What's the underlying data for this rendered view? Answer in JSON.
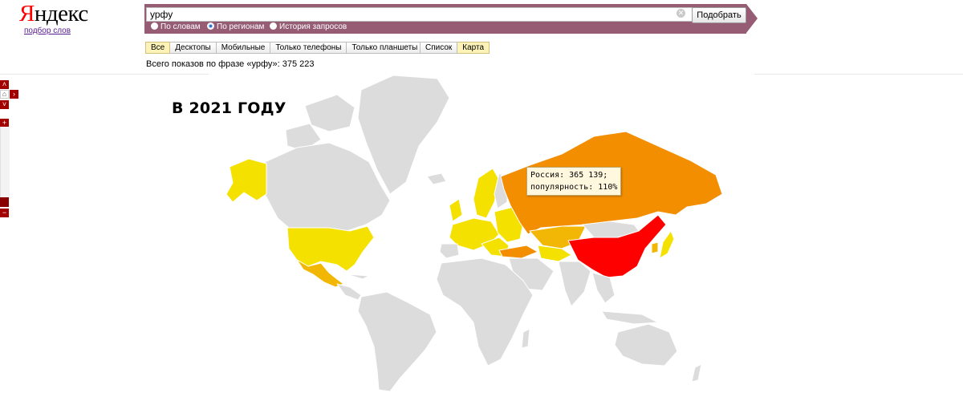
{
  "logo": {
    "brand": "Яндекс",
    "subtitle": "подбор слов"
  },
  "search": {
    "query": "урфу",
    "submit_label": "Подобрать"
  },
  "modes": [
    {
      "label": "По словам",
      "selected": false
    },
    {
      "label": "По регионам",
      "selected": true
    },
    {
      "label": "История запросов",
      "selected": false
    }
  ],
  "device_tabs": [
    {
      "label": "Все",
      "active": true
    },
    {
      "label": "Десктопы",
      "active": false
    },
    {
      "label": "Мобильные",
      "active": false
    },
    {
      "label": "Только телефоны",
      "active": false
    },
    {
      "label": "Только планшеты",
      "active": false
    }
  ],
  "view_tabs": [
    {
      "label": "Список",
      "active": false
    },
    {
      "label": "Карта",
      "active": true
    }
  ],
  "total_line": "Всего показов по фразе «урфу»: 375 223",
  "map": {
    "overlay_title": "В 2021 ГОДУ",
    "tooltip": {
      "line1": "Россия: 365 139;",
      "line2": "популярность: 110%"
    },
    "colors": {
      "base": "#dcdcdc",
      "low": "#f5e100",
      "mid": "#f2b705",
      "high": "#f28e00",
      "top": "#ff0000",
      "ocean": "#ffffff"
    }
  },
  "zoom": {
    "zoom_in": "+",
    "zoom_out": "−",
    "up": "˄",
    "down": "˅",
    "right": "›"
  }
}
